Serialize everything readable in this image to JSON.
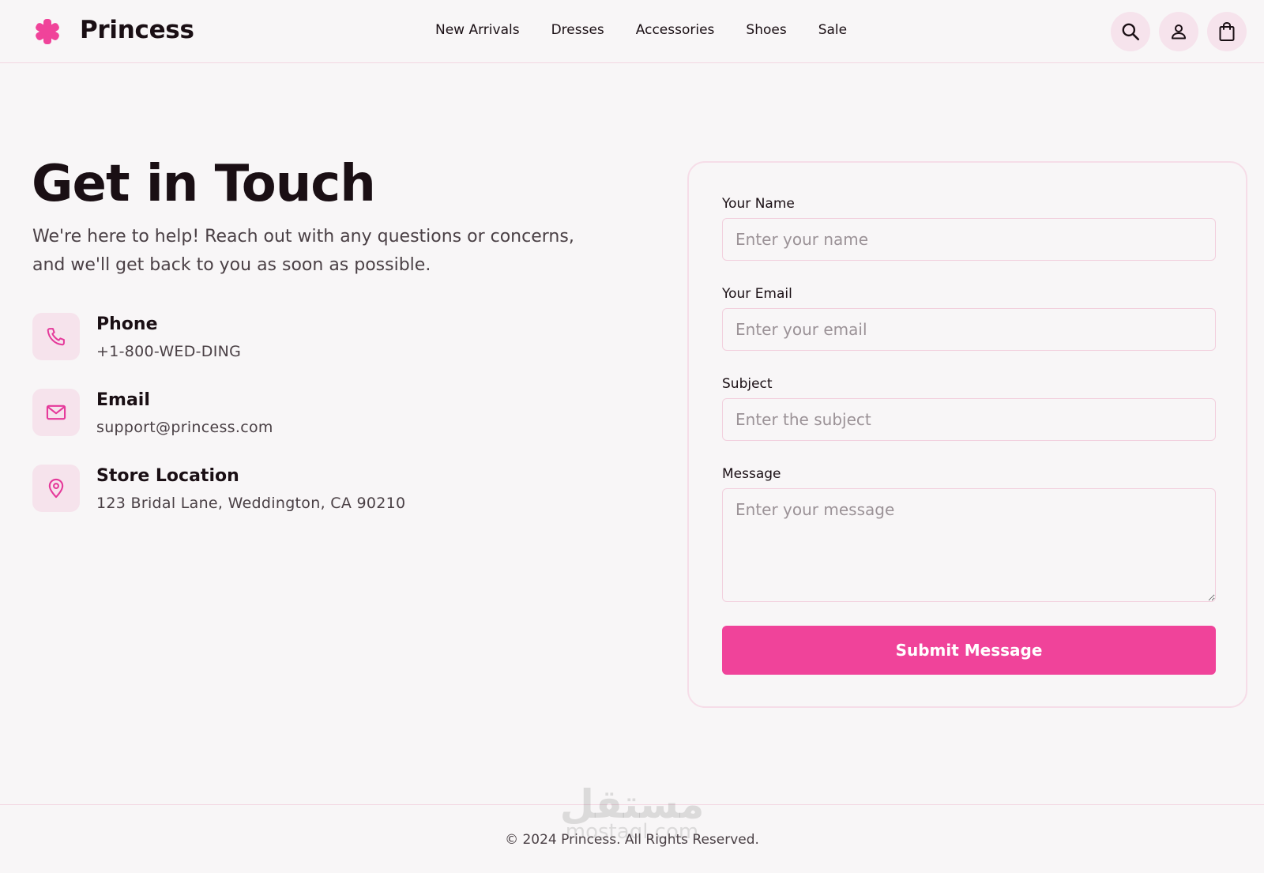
{
  "brand": {
    "name": "Princess",
    "logo_icon": "asterisk-icon",
    "accent_color": "#f0439a"
  },
  "nav": {
    "items": [
      {
        "label": "New Arrivals"
      },
      {
        "label": "Dresses"
      },
      {
        "label": "Accessories"
      },
      {
        "label": "Shoes"
      },
      {
        "label": "Sale"
      }
    ]
  },
  "header_actions": {
    "icons": [
      "search-icon",
      "user-icon",
      "shopping-bag-icon"
    ]
  },
  "hero": {
    "title": "Get in Touch",
    "description": "We're here to help! Reach out with any questions or concerns, and we'll get back to you as soon as possible."
  },
  "contacts": [
    {
      "icon": "phone-icon",
      "title": "Phone",
      "value": "+1-800-WED-DING"
    },
    {
      "icon": "mail-icon",
      "title": "Email",
      "value": "support@princess.com"
    },
    {
      "icon": "map-pin-icon",
      "title": "Store Location",
      "value": "123 Bridal Lane, Weddington, CA 90210"
    }
  ],
  "form": {
    "name": {
      "label": "Your Name",
      "placeholder": "Enter your name",
      "value": ""
    },
    "email": {
      "label": "Your Email",
      "placeholder": "Enter your email",
      "value": ""
    },
    "subject": {
      "label": "Subject",
      "placeholder": "Enter the subject",
      "value": ""
    },
    "message": {
      "label": "Message",
      "placeholder": "Enter your message",
      "value": ""
    },
    "submit_label": "Submit Message"
  },
  "footer": {
    "copyright": "© 2024 Princess. All Rights Reserved."
  },
  "watermark": {
    "arabic": "مستقل",
    "latin": "mostaql.com"
  }
}
